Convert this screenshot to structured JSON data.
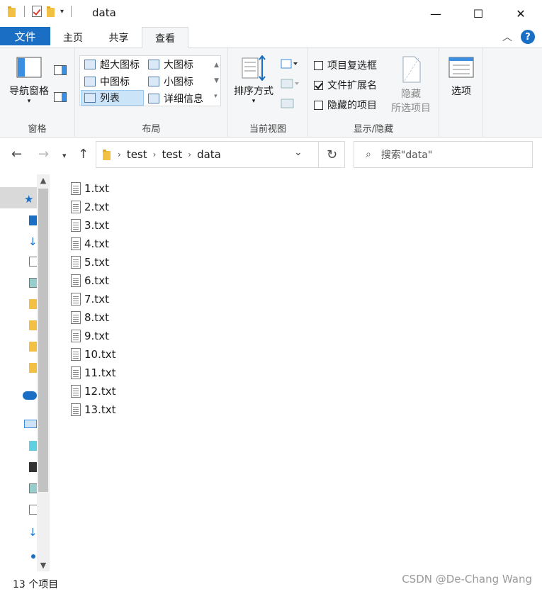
{
  "window": {
    "title": "data",
    "minimize_glyph": "—",
    "maximize_glyph": "☐",
    "close_glyph": "✕"
  },
  "ribbon_tabs": {
    "file": "文件",
    "home": "主页",
    "share": "共享",
    "view": "查看",
    "collapse_glyph": "︿",
    "help_glyph": "?"
  },
  "ribbon": {
    "pane_group": {
      "label": "窗格",
      "nav_pane": "导航窗格"
    },
    "layout_group": {
      "label": "布局",
      "items": [
        "超大图标",
        "大图标",
        "中图标",
        "小图标",
        "列表",
        "详细信息"
      ],
      "selected": "列表"
    },
    "current_view_group": {
      "label": "当前视图",
      "sort_by": "排序方式"
    },
    "show_hide_group": {
      "label": "显示/隐藏",
      "item_checkboxes": "项目复选框",
      "item_checkboxes_checked": false,
      "file_extensions": "文件扩展名",
      "file_extensions_checked": true,
      "hidden_items": "隐藏的项目",
      "hidden_items_checked": false,
      "hide_selected_line1": "隐藏",
      "hide_selected_line2": "所选项目"
    },
    "options": "选项"
  },
  "address": {
    "crumbs": [
      "test",
      "test",
      "data"
    ],
    "search_placeholder": "搜索\"data\""
  },
  "files": [
    "1.txt",
    "2.txt",
    "3.txt",
    "4.txt",
    "5.txt",
    "6.txt",
    "7.txt",
    "8.txt",
    "9.txt",
    "10.txt",
    "11.txt",
    "12.txt",
    "13.txt"
  ],
  "status": {
    "count": "13 个项目"
  },
  "watermark": "CSDN @De-Chang Wang",
  "colors": {
    "accent": "#1a6fc4",
    "ribbon_bg": "#f5f6f7",
    "folder": "#f2c043"
  }
}
